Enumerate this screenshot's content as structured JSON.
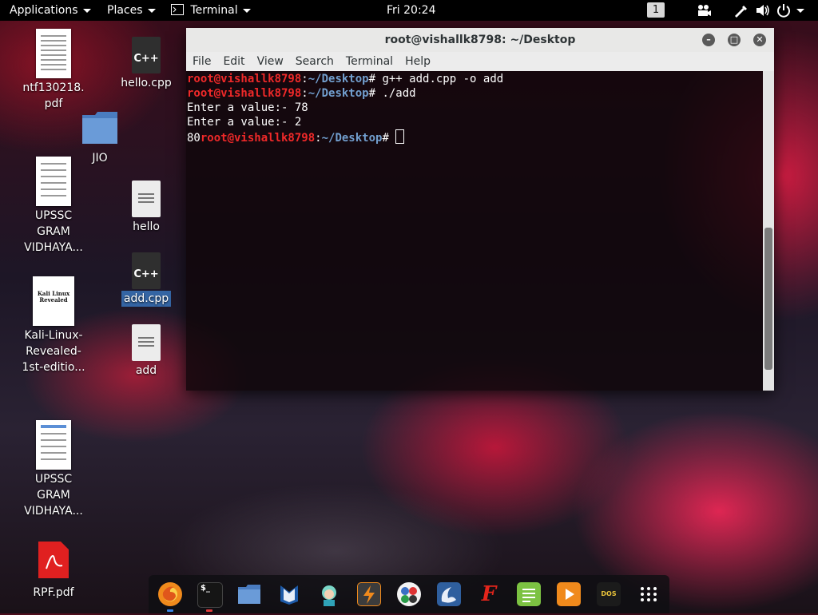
{
  "topbar": {
    "applications": "Applications",
    "places": "Places",
    "app_name": "Terminal",
    "clock": "Fri 20:24",
    "workspace": "1",
    "icons": [
      "camera-icon",
      "pen-icon",
      "volume-icon",
      "power-icon"
    ]
  },
  "desktop": {
    "icons": [
      {
        "name": "ntf130218.pdf",
        "label": "ntf130218.\npdf"
      },
      {
        "name": "hello.cpp",
        "label": "hello.cpp"
      },
      {
        "name": "JIO",
        "label": "JIO"
      },
      {
        "name": "UPSSC GRAM VIDHAYA (1)",
        "label": "UPSSC GRAM VIDHAYA..."
      },
      {
        "name": "hello",
        "label": "hello"
      },
      {
        "name": "add.cpp",
        "label": "add.cpp"
      },
      {
        "name": "Kali-Linux-Revealed",
        "label": "Kali-Linux-Revealed-1st-editio..."
      },
      {
        "name": "add",
        "label": "add"
      },
      {
        "name": "UPSSC GRAM VIDHAYA (2)",
        "label": "UPSSC GRAM VIDHAYA..."
      },
      {
        "name": "RPF.pdf",
        "label": "RPF.pdf"
      }
    ],
    "book_cover_title": "Kali Linux Revealed",
    "cpp_badge": "C++"
  },
  "terminal": {
    "title": "root@vishallk8798: ~/Desktop",
    "menu": [
      "File",
      "Edit",
      "View",
      "Search",
      "Terminal",
      "Help"
    ],
    "prompt_user": "root@vishallk8798",
    "prompt_sep": ":",
    "prompt_path": "~/Desktop",
    "prompt_end": "# ",
    "cmd1": "g++ add.cpp -o add",
    "cmd2": "./add",
    "out1": "Enter a value:- 78",
    "out2": "Enter a value:- 2",
    "out3_prefix": "80"
  },
  "dock": {
    "apps": [
      "firefox-icon",
      "terminal-icon",
      "files-icon",
      "metasploit-icon",
      "armitage-icon",
      "burpsuite-icon",
      "maltego-icon",
      "wireshark-icon",
      "faraday-icon",
      "leafpad-icon",
      "media-player-icon",
      "dosbox-icon",
      "app-grid-icon"
    ],
    "terminal_glyph": "$_",
    "dosbox_label": "DOS",
    "faraday_glyph": "F"
  },
  "colors": {
    "prompt_user": "#ef2929",
    "prompt_path": "#729fcf",
    "selection": "#3465a4",
    "topbar": "#000000"
  }
}
